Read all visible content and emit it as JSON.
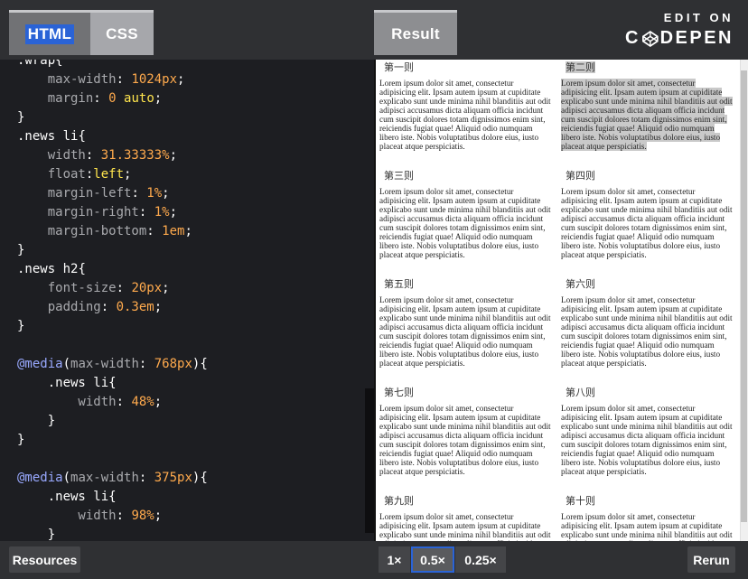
{
  "tabs": {
    "html": "HTML",
    "css": "CSS",
    "result": "Result"
  },
  "branding": {
    "edit_on": "EDIT ON",
    "codepen_left": "C",
    "codepen_right": "DEPEN"
  },
  "code_lines": [
    [
      {
        "t": ".wrap",
        "c": "k-sel"
      },
      {
        "t": "{",
        "c": "k-pun"
      }
    ],
    [
      {
        "t": "    max-width",
        "c": "k-prop"
      },
      {
        "t": ": ",
        "c": "k-pun"
      },
      {
        "t": "1024px",
        "c": "k-num"
      },
      {
        "t": ";",
        "c": "k-pun"
      }
    ],
    [
      {
        "t": "    margin",
        "c": "k-prop"
      },
      {
        "t": ": ",
        "c": "k-pun"
      },
      {
        "t": "0",
        "c": "k-num"
      },
      {
        "t": " ",
        "c": "k-pun"
      },
      {
        "t": "auto",
        "c": "k-val"
      },
      {
        "t": ";",
        "c": "k-pun"
      }
    ],
    [
      {
        "t": "}",
        "c": "k-pun"
      }
    ],
    [
      {
        "t": ".news li",
        "c": "k-sel"
      },
      {
        "t": "{",
        "c": "k-pun"
      }
    ],
    [
      {
        "t": "    width",
        "c": "k-prop"
      },
      {
        "t": ": ",
        "c": "k-pun"
      },
      {
        "t": "31.33333%",
        "c": "k-num"
      },
      {
        "t": ";",
        "c": "k-pun"
      }
    ],
    [
      {
        "t": "    float",
        "c": "k-prop"
      },
      {
        "t": ":",
        "c": "k-pun"
      },
      {
        "t": "left",
        "c": "k-val"
      },
      {
        "t": ";",
        "c": "k-pun"
      }
    ],
    [
      {
        "t": "    margin-left",
        "c": "k-prop"
      },
      {
        "t": ": ",
        "c": "k-pun"
      },
      {
        "t": "1%",
        "c": "k-num"
      },
      {
        "t": ";",
        "c": "k-pun"
      }
    ],
    [
      {
        "t": "    margin-right",
        "c": "k-prop"
      },
      {
        "t": ": ",
        "c": "k-pun"
      },
      {
        "t": "1%",
        "c": "k-num"
      },
      {
        "t": ";",
        "c": "k-pun"
      }
    ],
    [
      {
        "t": "    margin-bottom",
        "c": "k-prop"
      },
      {
        "t": ": ",
        "c": "k-pun"
      },
      {
        "t": "1em",
        "c": "k-num"
      },
      {
        "t": ";",
        "c": "k-pun"
      }
    ],
    [
      {
        "t": "}",
        "c": "k-pun"
      }
    ],
    [
      {
        "t": ".news h2",
        "c": "k-sel"
      },
      {
        "t": "{",
        "c": "k-pun"
      }
    ],
    [
      {
        "t": "    font-size",
        "c": "k-prop"
      },
      {
        "t": ": ",
        "c": "k-pun"
      },
      {
        "t": "20px",
        "c": "k-num"
      },
      {
        "t": ";",
        "c": "k-pun"
      }
    ],
    [
      {
        "t": "    padding",
        "c": "k-prop"
      },
      {
        "t": ": ",
        "c": "k-pun"
      },
      {
        "t": "0.3em",
        "c": "k-num"
      },
      {
        "t": ";",
        "c": "k-pun"
      }
    ],
    [
      {
        "t": "}",
        "c": "k-pun"
      }
    ],
    [
      {
        "t": "",
        "c": "k-pun"
      }
    ],
    [
      {
        "t": "@media",
        "c": "k-at"
      },
      {
        "t": "(",
        "c": "k-pun"
      },
      {
        "t": "max-width",
        "c": "k-prop"
      },
      {
        "t": ": ",
        "c": "k-pun"
      },
      {
        "t": "768px",
        "c": "k-num"
      },
      {
        "t": "){",
        "c": "k-pun"
      }
    ],
    [
      {
        "t": "    .news li",
        "c": "k-sel"
      },
      {
        "t": "{",
        "c": "k-pun"
      }
    ],
    [
      {
        "t": "        width",
        "c": "k-prop"
      },
      {
        "t": ": ",
        "c": "k-pun"
      },
      {
        "t": "48%",
        "c": "k-num"
      },
      {
        "t": ";",
        "c": "k-pun"
      }
    ],
    [
      {
        "t": "    }",
        "c": "k-pun"
      }
    ],
    [
      {
        "t": "}",
        "c": "k-pun"
      }
    ],
    [
      {
        "t": "",
        "c": "k-pun"
      }
    ],
    [
      {
        "t": "@media",
        "c": "k-at"
      },
      {
        "t": "(",
        "c": "k-pun"
      },
      {
        "t": "max-width",
        "c": "k-prop"
      },
      {
        "t": ": ",
        "c": "k-pun"
      },
      {
        "t": "375px",
        "c": "k-num"
      },
      {
        "t": "){",
        "c": "k-pun"
      }
    ],
    [
      {
        "t": "    .news li",
        "c": "k-sel"
      },
      {
        "t": "{",
        "c": "k-pun"
      }
    ],
    [
      {
        "t": "        width",
        "c": "k-prop"
      },
      {
        "t": ": ",
        "c": "k-pun"
      },
      {
        "t": "98%",
        "c": "k-num"
      },
      {
        "t": ";",
        "c": "k-pun"
      }
    ],
    [
      {
        "t": "    }",
        "c": "k-pun"
      }
    ]
  ],
  "news": {
    "body_text": "Lorem ipsum dolor sit amet, consectetur adipisicing elit. Ipsam autem ipsum at cupiditate explicabo sunt unde minima nihil blanditiis aut odit adipisci accusamus dicta aliquam officia incidunt cum suscipit dolores totam dignissimos enim sint, reiciendis fugiat quae! Aliquid odio numquam libero iste. Nobis voluptatibus dolore eius, iusto placeat atque perspiciatis.",
    "titles": [
      "第一则",
      "第二则",
      "第三则",
      "第四则",
      "第五则",
      "第六则",
      "第七则",
      "第八则",
      "第九则",
      "第十则"
    ]
  },
  "bottom": {
    "resources": "Resources",
    "rerun": "Rerun",
    "zoom_options": [
      "1×",
      "0.5×",
      "0.25×"
    ]
  },
  "colors": {
    "accent": "#2a63d6",
    "bar_bg": "#2f3033",
    "editor_bg": "#1d1e22"
  }
}
